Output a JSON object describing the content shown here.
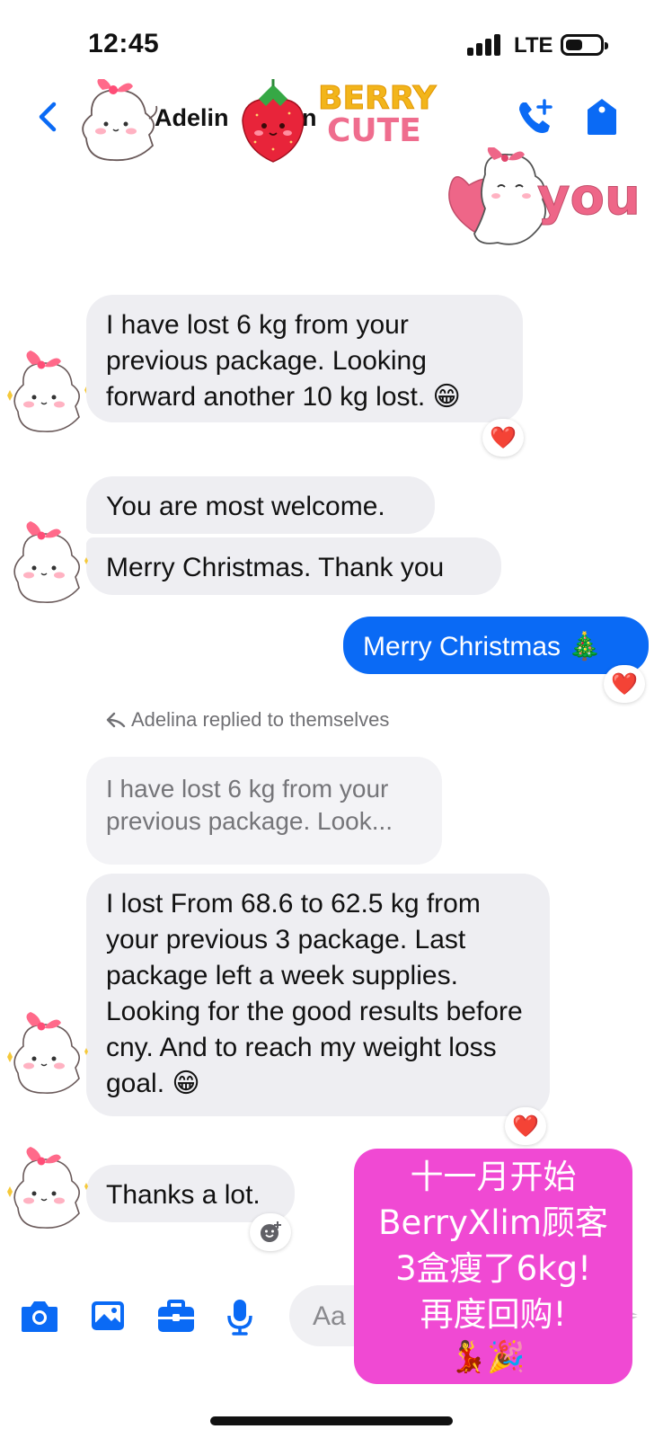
{
  "status_bar": {
    "time": "12:45",
    "network": "LTE"
  },
  "header": {
    "contact_name": "Adelin",
    "contact_name_tail": "n",
    "sticker_line1": "BERRY",
    "sticker_line2": "CUTE"
  },
  "top_sticker": {
    "text": "you"
  },
  "messages": {
    "m1": "I have lost 6 kg from  your previous package. Looking forward another 10 kg lost. 😁",
    "m2": "You are most welcome.",
    "m3": "Merry Christmas. Thank you",
    "m4": "Merry Christmas 🎄",
    "reply_note": "Adelina replied to themselves",
    "quoted": "I have lost 6 kg from  your previous package. Look...",
    "m5": "I lost From 68.6 to 62.5 kg from your previous 3 package. Last package left a week supplies. Looking for the good results before cny. And to reach my weight loss goal. 😁",
    "m6": "Thanks a lot."
  },
  "reactions": {
    "heart": "❤️"
  },
  "composer": {
    "placeholder": "Aa"
  },
  "promo": {
    "line1": "十一月开始",
    "line2": "BerryXlim顾客",
    "line3": "3盒瘦了6kg!",
    "line4": "再度回购!",
    "emojis": "💃🎉"
  },
  "colors": {
    "accent": "#0a6af5",
    "incoming_bubble": "#eeeef2",
    "promo_bg": "#f049d3"
  }
}
